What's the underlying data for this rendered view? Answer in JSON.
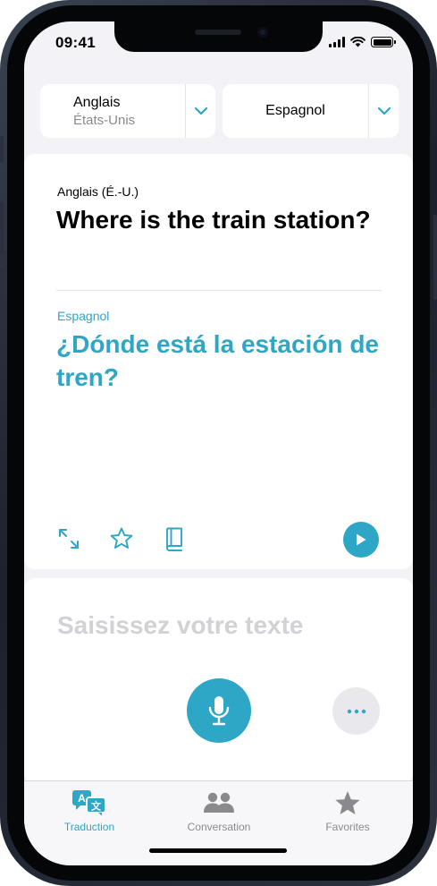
{
  "status_bar": {
    "time": "09:41"
  },
  "languages": {
    "source": {
      "name": "Anglais",
      "region": "États-Unis"
    },
    "target": {
      "name": "Espagnol"
    }
  },
  "translation": {
    "source_label": "Anglais (É.-U.)",
    "source_text": "Where is the train station?",
    "target_label": "Espagnol",
    "target_text": "¿Dónde está la estación de tren?"
  },
  "input": {
    "placeholder": "Saisissez votre texte"
  },
  "tabs": [
    {
      "label": "Traduction",
      "icon": "translate-icon",
      "active": true
    },
    {
      "label": "Conversation",
      "icon": "people-icon",
      "active": false
    },
    {
      "label": "Favorites",
      "icon": "star-icon",
      "active": false
    }
  ],
  "colors": {
    "accent": "#2ea6c6",
    "placeholder": "#d1d1d6",
    "background": "#f2f2f7"
  }
}
